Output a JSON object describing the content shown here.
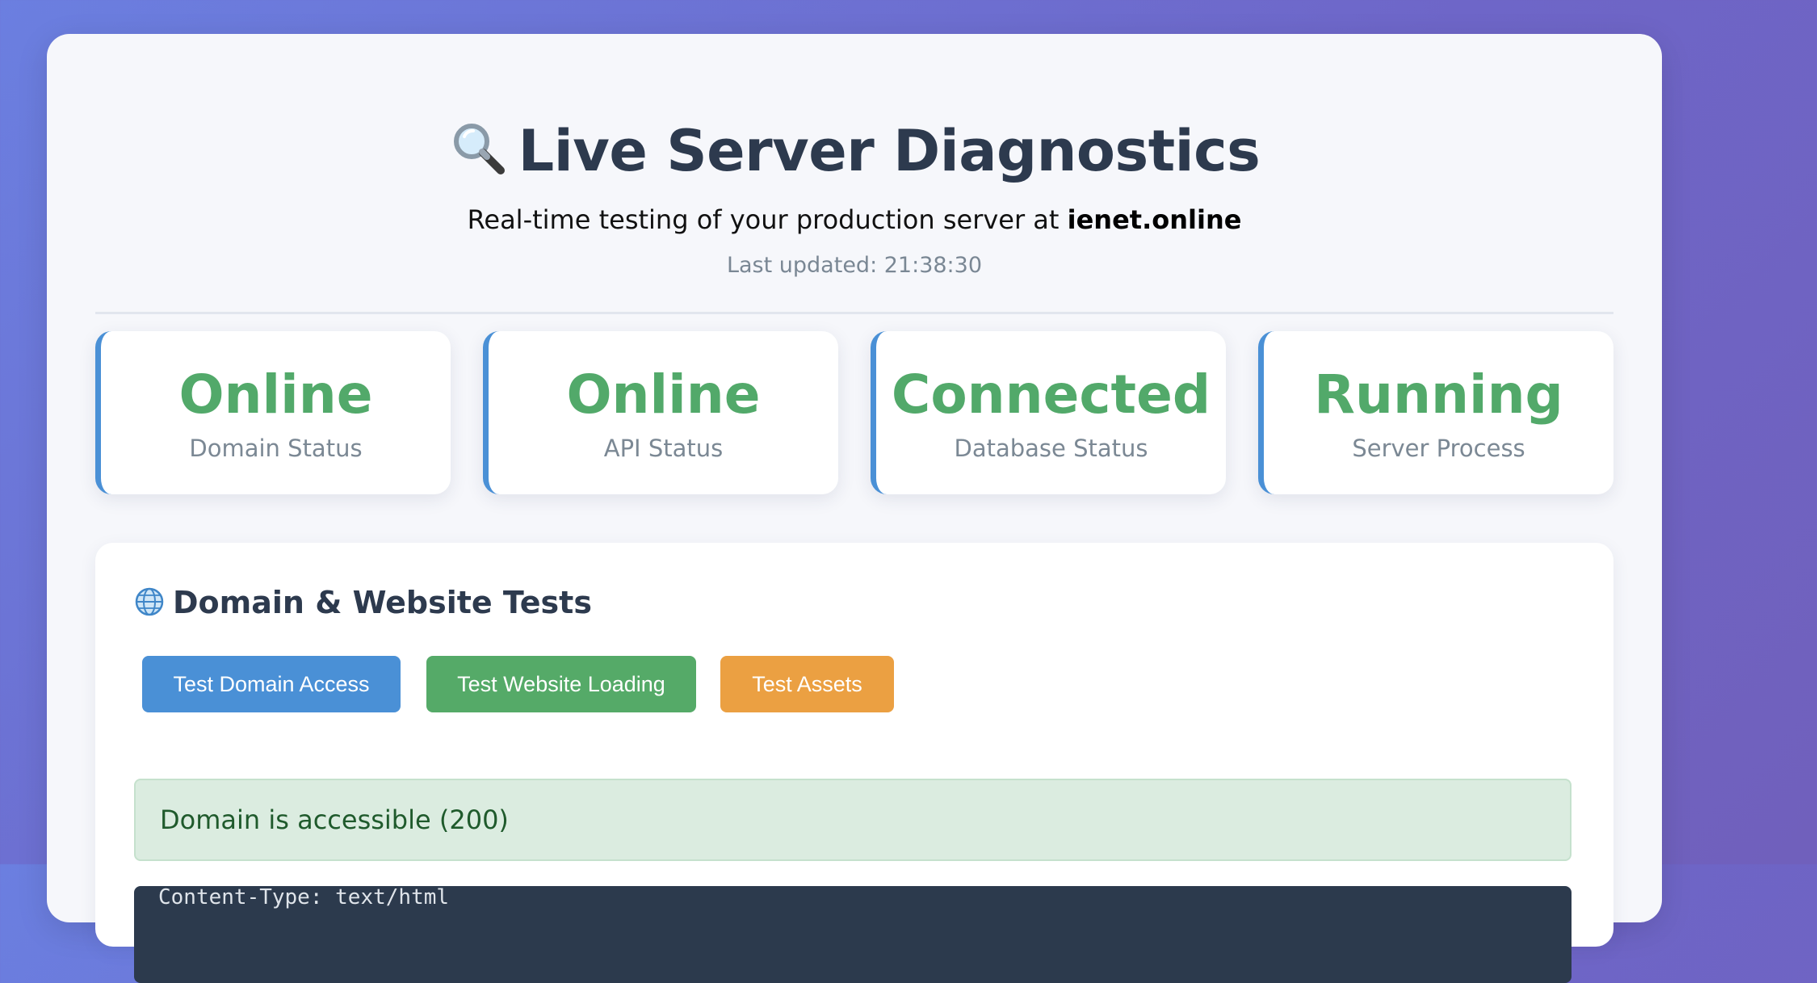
{
  "header": {
    "icon": "magnifying-glass-icon",
    "title": "Live Server Diagnostics",
    "subtitle_prefix": "Real-time testing of your production server at ",
    "subtitle_domain": "ienet.online",
    "last_updated": "Last updated: 21:38:30"
  },
  "status_cards": [
    {
      "value": "Online",
      "label": "Domain Status"
    },
    {
      "value": "Online",
      "label": "API Status"
    },
    {
      "value": "Connected",
      "label": "Database Status"
    },
    {
      "value": "Running",
      "label": "Server Process"
    }
  ],
  "domain_section": {
    "icon": "globe-icon",
    "title": "Domain & Website Tests",
    "buttons": [
      {
        "label": "Test Domain Access",
        "color": "#4a90d6"
      },
      {
        "label": "Test Website Loading",
        "color": "#55aa68"
      },
      {
        "label": "Test Assets",
        "color": "#eba042"
      }
    ],
    "result_message": "Domain is accessible (200)",
    "code_output": "Content-Type: text/html"
  },
  "colors": {
    "accent": "#4a90d6",
    "success": "#52a96a",
    "warning": "#eba042",
    "title": "#2d3a4e"
  }
}
